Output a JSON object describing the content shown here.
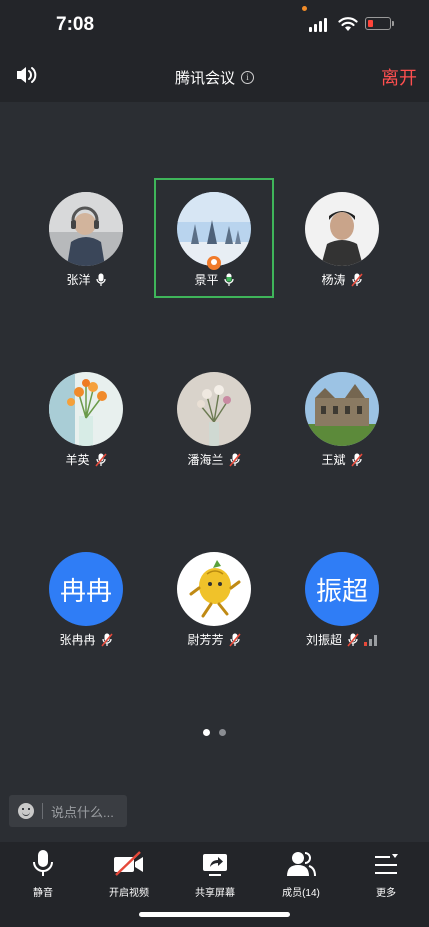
{
  "status_bar": {
    "time": "7:08"
  },
  "header": {
    "title": "腾讯会议",
    "leave_label": "离开"
  },
  "participants": [
    {
      "name": "张洋",
      "mic": "on"
    },
    {
      "name": "景平",
      "mic": "speaking",
      "host": true,
      "active": true
    },
    {
      "name": "杨涛",
      "mic": "muted"
    },
    {
      "name": "羊英",
      "mic": "muted"
    },
    {
      "name": "潘海兰",
      "mic": "muted"
    },
    {
      "name": "王斌",
      "mic": "muted"
    },
    {
      "name": "张冉冉",
      "mic": "muted",
      "avatar_text": "冉冉"
    },
    {
      "name": "尉芳芳",
      "mic": "muted"
    },
    {
      "name": "刘振超",
      "mic": "muted",
      "avatar_text": "振超",
      "network_signal": true
    }
  ],
  "pagination": {
    "pages": 2,
    "current": 1
  },
  "chat": {
    "placeholder": "说点什么..."
  },
  "toolbar": {
    "mute": "静音",
    "video": "开启视频",
    "share": "共享屏幕",
    "members": "成员(14)",
    "more": "更多"
  },
  "colors": {
    "background": "#2b2e33",
    "bar": "#232529",
    "leave": "#ff4f4f",
    "active_border": "#3fb55a",
    "avatar_blue": "#2f7df6",
    "muted_red": "#e5493a"
  }
}
